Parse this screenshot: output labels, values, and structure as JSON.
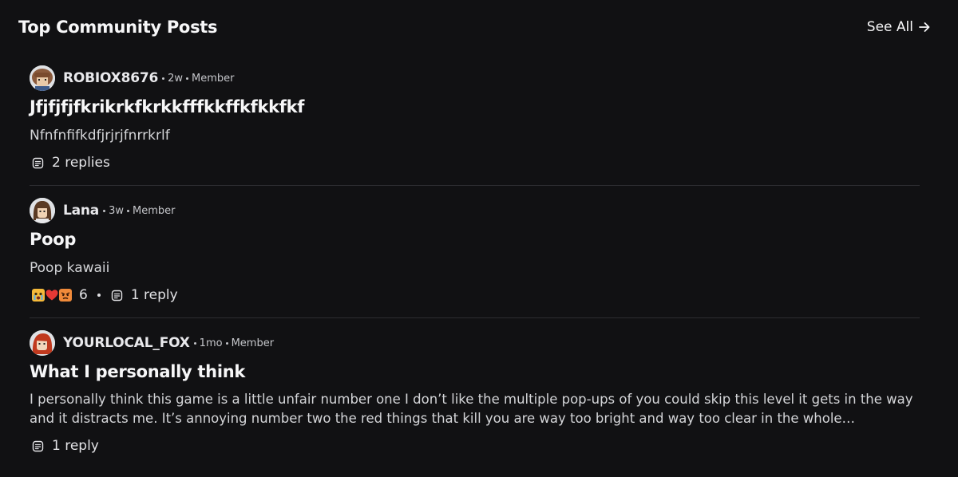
{
  "header": {
    "title": "Top Community Posts",
    "see_all_label": "See All"
  },
  "posts": [
    {
      "username": "ROBIOX8676",
      "age": "2w",
      "role": "Member",
      "title": "Jfjfjfjfkrikrkfkrkkfffkkffkfkkfkf",
      "body": "Nfnfnfifkdfjrjrjfnrrkrlf",
      "replies_label": "2 replies",
      "reactions": null
    },
    {
      "username": "Lana",
      "age": "3w",
      "role": "Member",
      "title": "Poop",
      "body": "Poop kawaii",
      "replies_label": "1 reply",
      "reactions": {
        "icons": [
          "crying-emoji",
          "heart-emoji",
          "angry-emoji"
        ],
        "count": "6"
      }
    },
    {
      "username": "YOURLOCAL_FOX",
      "age": "1mo",
      "role": "Member",
      "title": "What I personally think",
      "body": "I personally think this game is a little unfair number one I don’t like the multiple pop-ups of you could skip this level it gets in the way and it distracts me. It’s annoying number two the red things that kill you are way too bright and way too clear in the whole…",
      "replies_label": "1 reply",
      "reactions": null
    }
  ],
  "colors": {
    "background": "#111113",
    "divider": "#2c2d31",
    "text_primary": "#f7f7f8",
    "text_secondary": "#c4c5c9"
  }
}
